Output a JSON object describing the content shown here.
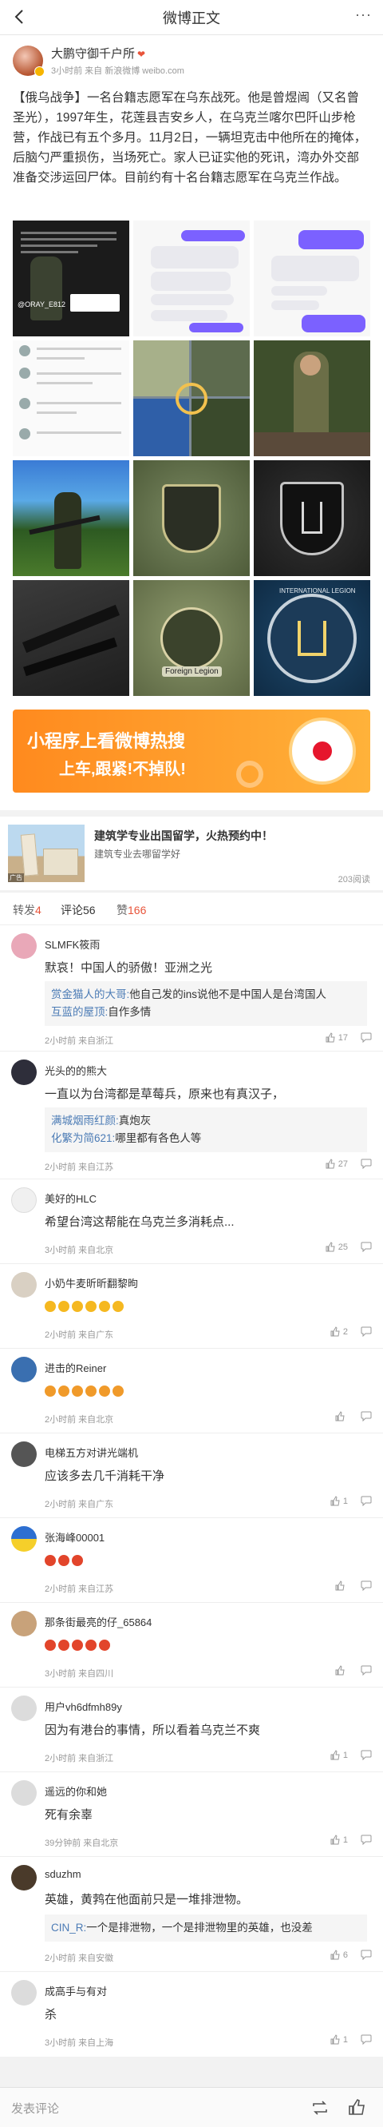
{
  "header": {
    "title": "微博正文",
    "more_label": "···"
  },
  "author": {
    "name": "大鹏守御千户所",
    "sub": "3小时前 来自 新浪微博 weibo.com"
  },
  "post": {
    "text": "【俄乌战争】一名台籍志愿军在乌东战死。他是曾煜闿（又名曾圣光），1997年生，花莲县吉安乡人，在乌克兰喀尔巴阡山步枪营，作战已有五个多月。11月2日，一辆坦克击中他所在的掩体，后脑勺严重损伤，当场死亡。家人已证实他的死讯，湾办外交部准备交涉运回尸体。目前约有十名台籍志愿军在乌克兰作战。"
  },
  "images": {
    "c1_tag": "@ORAY_E812",
    "c11_label": "Foreign Legion",
    "c12_label": "INTERNATIONAL LEGION"
  },
  "banner": {
    "line1": "小程序上看微博热搜",
    "line2": "上车,跟紧!不掉队!"
  },
  "ad": {
    "title": "建筑学专业出国留学，火热预约中！",
    "subtitle": "建筑专业去哪留学好",
    "reads": "203阅读"
  },
  "tabs": [
    {
      "label": "转发",
      "count": "4"
    },
    {
      "label": "评论",
      "count": "56"
    },
    {
      "label": "赞",
      "count": "166"
    }
  ],
  "comments": [
    {
      "name": "SLMFK筱雨",
      "text": "默哀！中国人的骄傲！亚洲之光",
      "replies": [
        {
          "user": "赏金猫人的大哥:",
          "text": "他自己发的ins说他不是中国人是台湾国人"
        },
        {
          "user": "互蓝的屋顶:",
          "text": "自作多情"
        }
      ],
      "time": "2小时前 来自浙江",
      "likes": "17"
    },
    {
      "name": "光头的的熊大",
      "text": "一直以为台湾都是草莓兵，原来也有真汉子，",
      "replies": [
        {
          "user": "满城烟雨红颜:",
          "text": "真炮灰"
        },
        {
          "user": "化繁为简621:",
          "text": "哪里都有各色人等"
        }
      ],
      "time": "2小时前 来自江苏",
      "likes": "27"
    },
    {
      "name": "美好的HLC",
      "text": "希望台湾这帮能在乌克兰多消耗点...",
      "replies": [],
      "time": "3小时前 来自北京",
      "likes": "25"
    },
    {
      "name": "小奶牛麦昕昕翻黎昫",
      "text": "",
      "replies": [],
      "time": "2小时前 来自广东",
      "likes": "2"
    },
    {
      "name": "进击的Reiner",
      "text": "",
      "replies": [],
      "time": "2小时前 来自北京",
      "likes": ""
    },
    {
      "name": "电梯五方对讲光端机",
      "text": "应该多去几千消耗干净",
      "replies": [],
      "time": "2小时前 来自广东",
      "likes": "1"
    },
    {
      "name": "张海峰00001",
      "text": "",
      "replies": [],
      "time": "2小时前 来自江苏",
      "likes": ""
    },
    {
      "name": "那条街最亮的仔_65864",
      "text": "",
      "replies": [],
      "time": "3小时前 来自四川",
      "likes": ""
    },
    {
      "name": "用户vh6dfmh89y",
      "text": "因为有港台的事情，所以看着乌克兰不爽",
      "replies": [],
      "time": "2小时前 来自浙江",
      "likes": "1"
    },
    {
      "name": "遥远的你和她",
      "text": "死有余辜",
      "replies": [],
      "time": "39分钟前 来自北京",
      "likes": "1"
    },
    {
      "name": "sduzhm",
      "text": "英雄，黄鹁在他面前只是一堆排泄物。",
      "replies": [
        {
          "user": "CIN_R:",
          "text": "一个是排泄物，一个是排泄物里的英雄，也没差"
        }
      ],
      "time": "2小时前 来自安徽",
      "likes": "6"
    },
    {
      "name": "成高手与有对",
      "text": "杀",
      "replies": [],
      "time": "3小时前 来自上海",
      "likes": "1"
    }
  ],
  "bottom": {
    "placeholder": "发表评论"
  }
}
